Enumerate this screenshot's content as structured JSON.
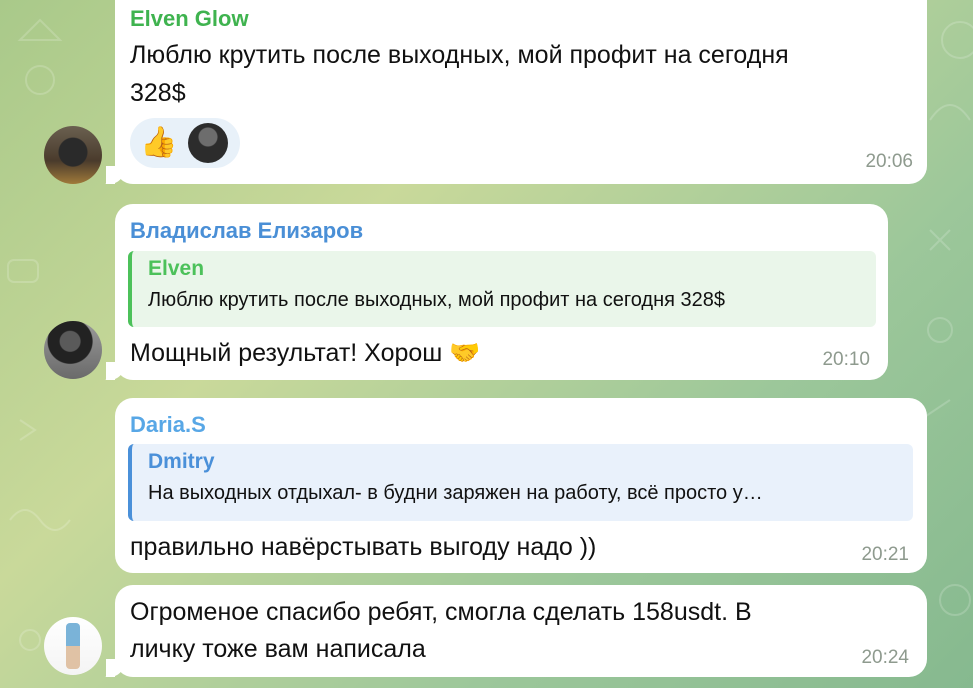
{
  "messages": [
    {
      "author": "Elven Glow",
      "text_line1": "Люблю крутить после выходных, мой профит на сегодня",
      "text_line2": "328$",
      "reaction_emoji": "👍",
      "time": "20:06"
    },
    {
      "author": "Владислав Елизаров",
      "reply_author": "Elven",
      "reply_text": "Люблю крутить после выходных, мой профит на сегодня 328$",
      "text": "Мощный результат! Хорош 🤝",
      "time": "20:10"
    },
    {
      "author": "Daria.S",
      "reply_author": "Dmitry",
      "reply_text": "На выходных отдыхал- в будни заряжен на работу, всё просто у…",
      "text": "правильно навёрстывать выгоду надо ))",
      "time": "20:21"
    },
    {
      "text_line1": "Огроменое спасибо ребят, смогла сделать 158usdt. В",
      "text_line2": "личку тоже вам написала",
      "time": "20:24"
    }
  ],
  "colors": {
    "elven_glow_name": "#3fb34f",
    "vladislav_name": "#4a8fd6",
    "daria_name": "#58a7e6",
    "reply_green_bar": "#4cc15a",
    "reply_green_bg": "#eaf6ea",
    "reply_blue_bar": "#4a90d9",
    "reply_blue_bg": "#e9f1fb"
  },
  "icons": [
    "thumbs-up-emoji",
    "handshake-emoji",
    "avatar"
  ]
}
